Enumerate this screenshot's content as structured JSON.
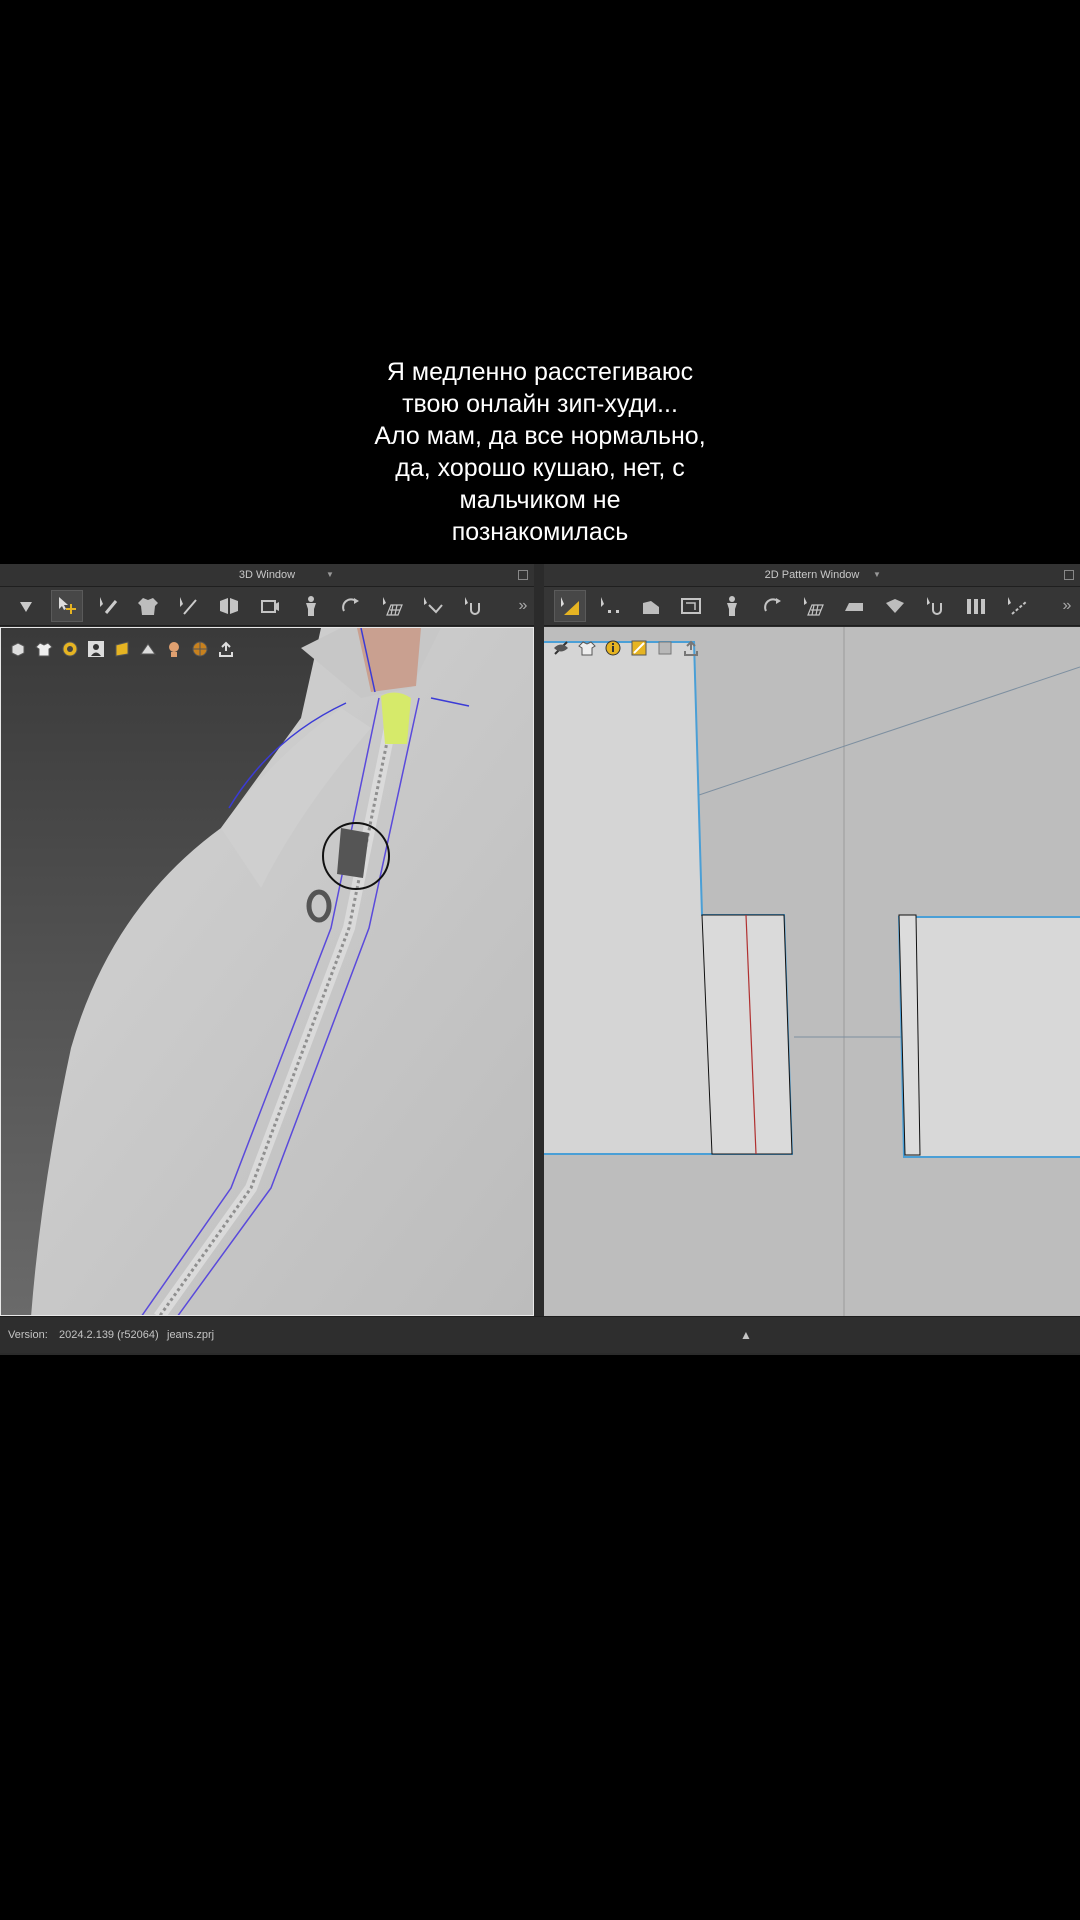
{
  "caption": {
    "lines": [
      "Я медленно расстегиваюс",
      "твою онлайн зип-худи...",
      "Ало мам, да все нормально,",
      "да, хорошо кушаю, нет, с",
      "мальчиком не",
      "познакомилась"
    ]
  },
  "window3d": {
    "title": "3D Window",
    "toolbar_icons": [
      "move-down-icon",
      "select-move-icon",
      "edit-brush-icon",
      "garment-icon",
      "pin-icon",
      "fold-icon",
      "camera-icon",
      "avatar-icon",
      "arrange-icon",
      "grid-icon",
      "sewing-icon",
      "zipper-icon"
    ],
    "view_icons": [
      "cube-view-icon",
      "garment-view-icon",
      "texture-view-icon",
      "avatar-view-icon",
      "shading-icon",
      "surface-icon",
      "skin-icon",
      "render-icon",
      "export-icon"
    ]
  },
  "window2d": {
    "title": "2D Pattern Window",
    "toolbar_icons": [
      "transform-pattern-icon",
      "edit-points-icon",
      "polygon-icon",
      "rectangle-icon",
      "avatar-icon",
      "arrange-icon",
      "grid-icon",
      "iron-icon",
      "fold-icon",
      "zipper-icon",
      "columns-icon",
      "line-tool-icon"
    ],
    "view_icons": [
      "eye-icon",
      "garment-view-icon",
      "info-icon",
      "texture-icon",
      "fabric-icon",
      "export-icon"
    ]
  },
  "status": {
    "version_label": "Version:",
    "version_value": "2024.2.139 (r52064)",
    "file_name": "jeans.zprj"
  },
  "colors": {
    "accent": "#e6b422",
    "outline_blue": "#4a9fd6",
    "seam_red": "#b03030",
    "zipper_tab": "#d6ea6a"
  }
}
